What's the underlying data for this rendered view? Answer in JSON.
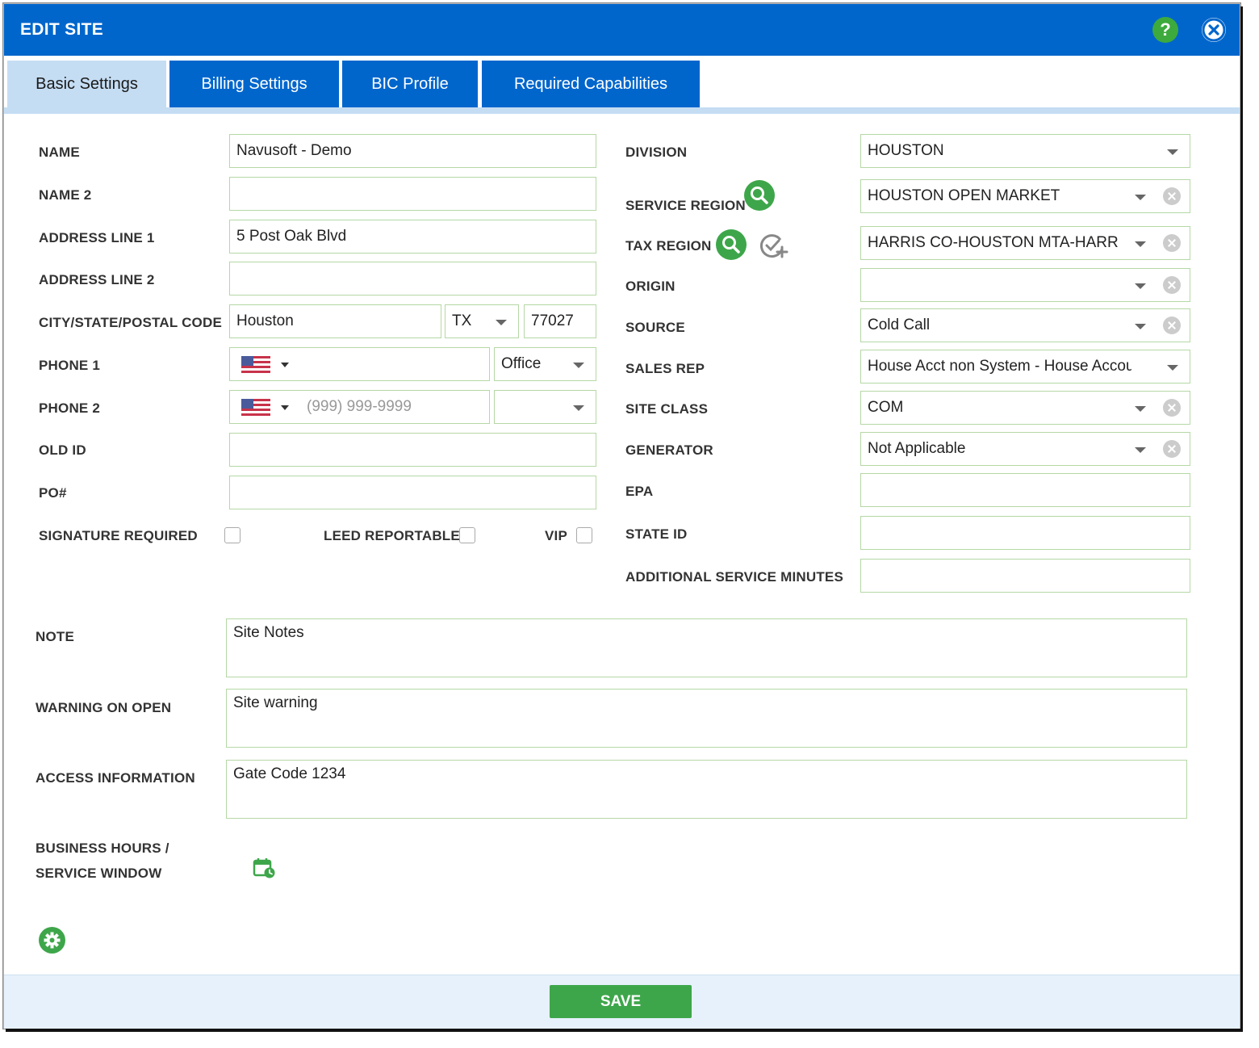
{
  "dialog": {
    "title": "EDIT SITE",
    "help_label": "?"
  },
  "tabs": [
    {
      "label": "Basic Settings",
      "active": true
    },
    {
      "label": "Billing Settings",
      "active": false
    },
    {
      "label": "BIC Profile",
      "active": false
    },
    {
      "label": "Required Capabilities",
      "active": false
    }
  ],
  "left": {
    "name": {
      "label": "NAME",
      "value": "Navusoft - Demo"
    },
    "name2": {
      "label": "NAME 2",
      "value": ""
    },
    "address1": {
      "label": "ADDRESS LINE 1",
      "value": "5 Post Oak Blvd"
    },
    "address2": {
      "label": "ADDRESS LINE 2",
      "value": ""
    },
    "city_state_zip": {
      "label": "CITY/STATE/POSTAL CODE",
      "city": "Houston",
      "state": "TX",
      "zip": "77027"
    },
    "phone1": {
      "label": "PHONE 1",
      "number": "",
      "type": "Office"
    },
    "phone2": {
      "label": "PHONE 2",
      "placeholder": "(999) 999-9999",
      "type": ""
    },
    "old_id": {
      "label": "OLD ID",
      "value": ""
    },
    "po": {
      "label": "PO#",
      "value": ""
    },
    "signature_required": {
      "label": "SIGNATURE REQUIRED",
      "checked": false
    },
    "leed_reportable": {
      "label": "LEED REPORTABLE",
      "checked": false
    },
    "vip": {
      "label": "VIP",
      "checked": false
    }
  },
  "right": {
    "division": {
      "label": "DIVISION",
      "value": "HOUSTON"
    },
    "service_region": {
      "label": "SERVICE REGION",
      "value": "HOUSTON OPEN MARKET"
    },
    "tax_region": {
      "label": "TAX REGION",
      "value": "HARRIS CO-HOUSTON MTA-HARR"
    },
    "origin": {
      "label": "ORIGIN",
      "value": ""
    },
    "source": {
      "label": "SOURCE",
      "value": "Cold Call"
    },
    "sales_rep": {
      "label": "SALES REP",
      "value": "House Acct non System - House Accou"
    },
    "site_class": {
      "label": "SITE CLASS",
      "value": "COM"
    },
    "generator": {
      "label": "GENERATOR",
      "value": "Not Applicable"
    },
    "epa": {
      "label": "EPA",
      "value": ""
    },
    "state_id": {
      "label": "STATE ID",
      "value": ""
    },
    "additional_minutes": {
      "label": "ADDITIONAL SERVICE MINUTES",
      "value": ""
    }
  },
  "notes": {
    "note": {
      "label": "NOTE",
      "value": "Site Notes"
    },
    "warning": {
      "label": "WARNING ON OPEN",
      "value": "Site warning"
    },
    "access": {
      "label": "ACCESS INFORMATION",
      "value": "Gate Code 1234"
    },
    "business_hours": {
      "label_line1": "BUSINESS HOURS /",
      "label_line2": "SERVICE WINDOW"
    }
  },
  "footer": {
    "save_label": "SAVE"
  },
  "colors": {
    "header_blue": "#0066cc",
    "active_tab": "#c5ddf3",
    "accent_green": "#3ea64a",
    "field_border": "#b5d8a5"
  }
}
